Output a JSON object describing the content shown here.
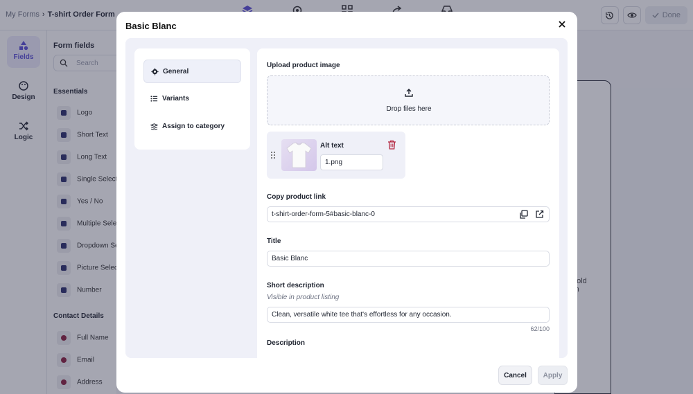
{
  "header": {
    "breadcrumb_root": "My Forms",
    "breadcrumb_sep": "›",
    "breadcrumb_current": "T-shirt Order Form",
    "done_label": "Done"
  },
  "rail": {
    "fields_label": "Fields",
    "design_label": "Design",
    "logic_label": "Logic"
  },
  "panel": {
    "title": "Form fields",
    "search_placeholder": "Search",
    "essentials_title": "Essentials",
    "essentials": [
      "Logo",
      "Short Text",
      "Long Text",
      "Single Select",
      "Yes / No",
      "Multiple Select",
      "Dropdown Se",
      "Picture Selec",
      "Number"
    ],
    "contact_title": "Contact Details",
    "contact": [
      "Full Name",
      "Email",
      "Address"
    ]
  },
  "canvas": {
    "peek_line1": "bold",
    "peek_line2": "rn"
  },
  "modal": {
    "title": "Basic Blanc",
    "nav": {
      "general": "General",
      "variants": "Variants",
      "assign": "Assign to category"
    },
    "upload_label": "Upload product image",
    "drop_text": "Drop files here",
    "alt_text_label": "Alt text",
    "alt_text_value": "1.png",
    "copy_link_label": "Copy product link",
    "product_link": "t-shirt-order-form-5#basic-blanc-0",
    "title_label": "Title",
    "title_value": "Basic Blanc",
    "short_desc_label": "Short description",
    "short_desc_hint": "Visible in product listing",
    "short_desc_value": "Clean, versatile white tee that's effortless for any occasion.",
    "char_count": "62/100",
    "description_label": "Description",
    "cancel_label": "Cancel",
    "apply_label": "Apply"
  }
}
